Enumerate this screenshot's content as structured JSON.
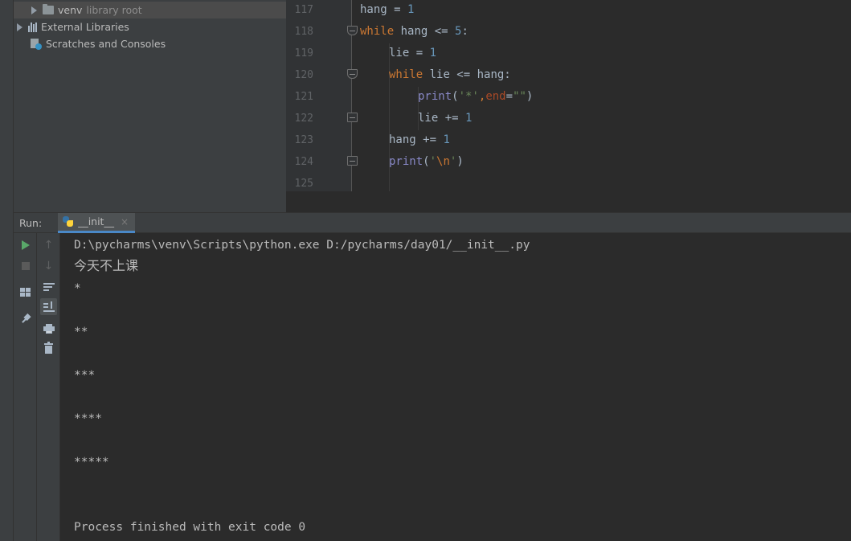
{
  "project_tree": {
    "items": [
      {
        "label": "venv",
        "suffix": "library root"
      },
      {
        "label": "External Libraries"
      },
      {
        "label": "Scratches and Consoles"
      }
    ]
  },
  "editor": {
    "line_numbers": [
      "117",
      "118",
      "119",
      "120",
      "121",
      "122",
      "123",
      "124",
      "125"
    ],
    "code": {
      "l117": {
        "var": "hang",
        "op": " = ",
        "num": "1"
      },
      "l118": {
        "kw": "while",
        "rest": " hang <= ",
        "num": "5",
        "colon": ":"
      },
      "l119": {
        "var": "lie",
        "op": " = ",
        "num": "1"
      },
      "l120": {
        "kw": "while",
        "rest": " lie <= hang:"
      },
      "l121": {
        "fn": "print",
        "open": "(",
        "str1": "'*'",
        "comma": ",",
        "param": "end",
        "eq": "=",
        "str2": "\"\"",
        "close": ")"
      },
      "l122": {
        "var": "lie",
        "op": " += ",
        "num": "1"
      },
      "l123": {
        "var": "hang",
        "op": " += ",
        "num": "1"
      },
      "l124": {
        "fn": "print",
        "open": "(",
        "str_a": "'",
        "esc": "\\n",
        "str_b": "'",
        "close": ")"
      }
    }
  },
  "run_panel": {
    "label": "Run:",
    "tab_title": "__init__",
    "close_glyph": "×"
  },
  "console": {
    "lines": [
      "D:\\pycharms\\venv\\Scripts\\python.exe D:/pycharms/day01/__init__.py",
      "今天不上课",
      "*",
      "**",
      "***",
      "****",
      "*****",
      "Process finished with exit code 0"
    ]
  },
  "toolbar_icons": {
    "col1": [
      "run-icon",
      "stop-icon",
      "layout-icon",
      "pin-icon"
    ],
    "col2": [
      "up-arrow-icon",
      "down-arrow-icon",
      "soft-wrap-icon",
      "scroll-to-end-icon",
      "print-icon",
      "trash-icon"
    ]
  },
  "colors": {
    "keyword": "#cc7832",
    "number": "#6897bb",
    "builtin": "#8888c6",
    "string": "#6a8759",
    "param": "#aa4926",
    "run_green": "#59a869",
    "tab_underline": "#4a88c7"
  }
}
